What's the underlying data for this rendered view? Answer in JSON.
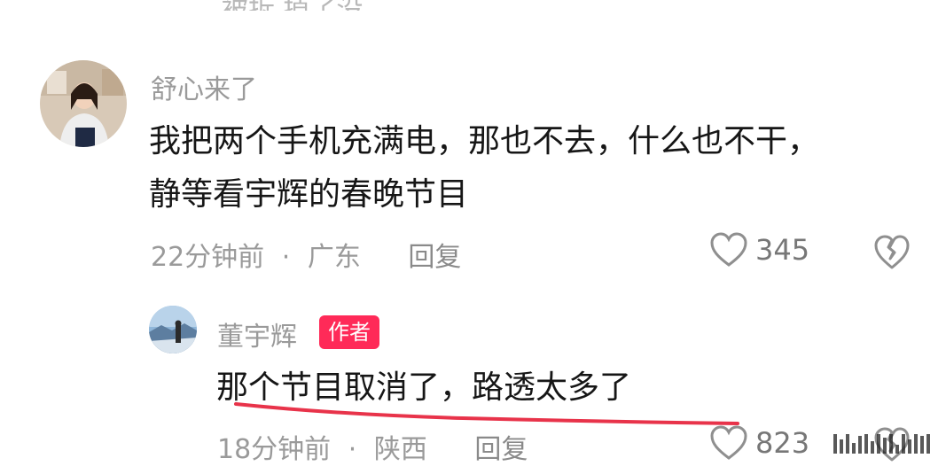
{
  "top_fragment": "被拆 掉了没",
  "comment1": {
    "username": "舒心来了",
    "text_line1": "我把两个手机充满电，那也不去，什么也不干，",
    "text_line2": "静等看宇辉的春晚节目",
    "time": "22分钟前",
    "separator": "·",
    "location": "广东",
    "reply": "回复",
    "likes": "345"
  },
  "comment2": {
    "username": "董宇辉",
    "badge": "作者",
    "text": "那个节目取消了，路透太多了",
    "time": "18分钟前",
    "separator": "·",
    "location": "陕西",
    "reply": "回复",
    "likes": "823"
  },
  "colors": {
    "badge": "#ff2a58",
    "underline": "#e8334a",
    "meta": "#9a9a9a"
  }
}
